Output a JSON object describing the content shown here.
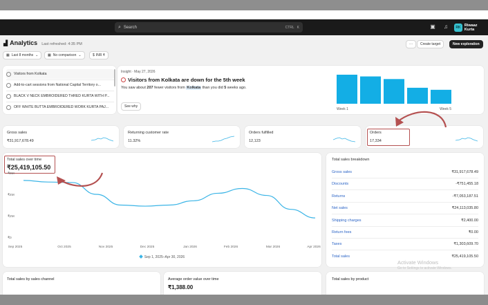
{
  "topbar": {
    "search_placeholder": "Search",
    "shortcut_ctrl": "CTRL",
    "shortcut_key": "K",
    "store_initials": "RK",
    "store_name": "Riwaaz Kurta"
  },
  "header": {
    "title": "Analytics",
    "last_refreshed": "Last refreshed: 4:35 PM",
    "filter_period": "Last 8 months",
    "filter_comparison": "No comparison",
    "filter_currency": "INR ₹",
    "more_label": "···",
    "create_target": "Create target",
    "new_exploration": "New exploration"
  },
  "sessions_list": [
    "Visitors from Kolkata",
    "Add-to-cart sessions from National Capital Territory o...",
    "BLACK V NECK EMBROIDERED THRED KURTA WITH P...",
    "OFF WHITE BUTTA EMBROIDERED WORK KURTA PAJ..."
  ],
  "insight": {
    "date": "Insight · May 27, 2026",
    "headline": "Visitors from Kolkata are down for the 5th week",
    "text_pre": "You saw about",
    "text_num": "207",
    "text_mid": "fewer visitors from",
    "text_city": "Kolkata",
    "text_post1": "than you did",
    "text_weeks": "5",
    "text_post2": "weeks ago.",
    "see_why": "See why",
    "week_start_label": "Week 1",
    "week_end_label": "Week 5",
    "bar_color": "#13aee5"
  },
  "chart_data": [
    {
      "type": "bar",
      "categories": [
        "Week 1",
        "Week 2",
        "Week 3",
        "Week 4",
        "Week 5"
      ],
      "values": [
        100,
        94,
        85,
        55,
        48
      ],
      "xlabel": "",
      "ylabel": ""
    },
    {
      "type": "line",
      "title": "Total sales over time",
      "x": [
        "Sep 2025",
        "Oct 2025",
        "Nov 2025",
        "Dec 2025",
        "Jan 2026",
        "Feb 2026",
        "Mar 2026",
        "Apr 2026"
      ],
      "y_tick_labels": [
        "₹6M",
        "₹4M",
        "₹2M",
        "₹0"
      ],
      "series": [
        {
          "name": "Sep 1, 2025–Apr 30, 2026",
          "values": [
            5.3,
            5.15,
            5.1,
            4.0,
            3.0,
            2.9,
            3.0,
            3.4,
            4.1,
            4.55,
            3.9,
            2.6,
            1.8
          ]
        }
      ],
      "ylim": [
        0,
        6
      ],
      "grid": false,
      "line_color": "#3ab4e6"
    }
  ],
  "metrics": [
    {
      "label": "Gross sales",
      "value": "₹31,917,678.49"
    },
    {
      "label": "Returning customer rate",
      "value": "11.32%"
    },
    {
      "label": "Orders fulfilled",
      "value": "12,123"
    },
    {
      "label": "Orders",
      "value": "17,334"
    }
  ],
  "total_sales": {
    "title": "Total sales over time",
    "value": "₹25,419,105.50",
    "legend": "Sep 1, 2025–Apr 30, 2026"
  },
  "breakdown": {
    "title": "Total sales breakdown",
    "rows": [
      {
        "label": "Gross sales",
        "value": "₹31,917,678.49"
      },
      {
        "label": "Discounts",
        "value": "-₹751,455.18"
      },
      {
        "label": "Returns",
        "value": "-₹7,053,187.51"
      },
      {
        "label": "Net sales",
        "value": "₹24,113,035.80"
      },
      {
        "label": "Shipping charges",
        "value": "₹2,400.00"
      },
      {
        "label": "Return fees",
        "value": "₹0.00"
      },
      {
        "label": "Taxes",
        "value": "₹1,303,609.70"
      },
      {
        "label": "Total sales",
        "value": "₹25,419,105.50"
      }
    ]
  },
  "bottom_cards": {
    "by_channel": "Total sales by sales channel",
    "aov": "Average order value over time",
    "aov_value": "₹1,388.00",
    "by_product": "Total sales by product"
  },
  "watermark": {
    "title": "Activate Windows",
    "subtitle": "Go to Settings to activate Windows."
  },
  "annotation_color": "#b45050"
}
